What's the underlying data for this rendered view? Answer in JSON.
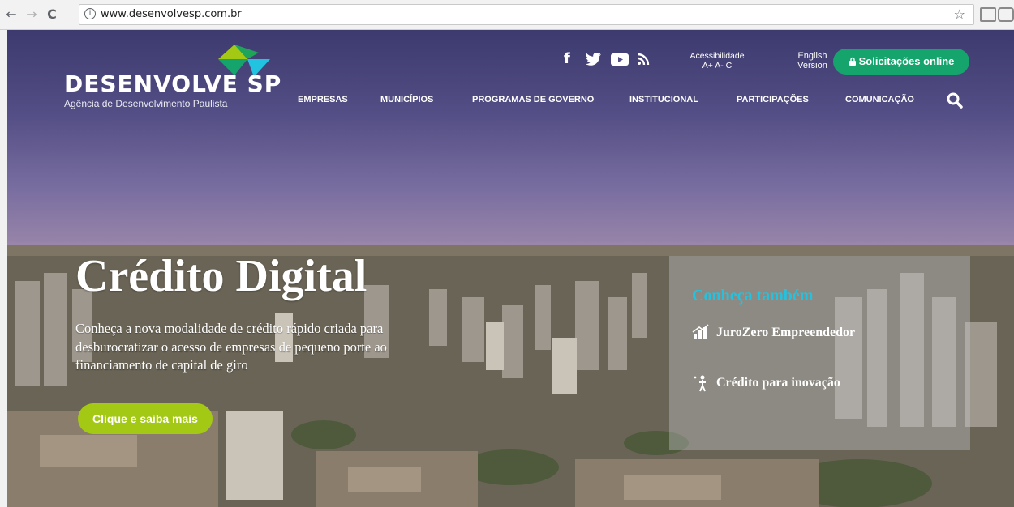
{
  "browser": {
    "url": "www.desenvolvesp.com.br",
    "back": "←",
    "forward": "→",
    "reload": "C",
    "info_icon": "ⓘ",
    "star_icon": "☆"
  },
  "header": {
    "brand_title": "DESENVOLVE SP",
    "brand_sub": "Agência de Desenvolvimento Paulista",
    "accessibility_label": "Acessibilidade",
    "accessibility_controls": "A+ A- C",
    "english_line1": "English",
    "english_line2": "Version",
    "online_button": "Solicitações online",
    "social": [
      "f",
      "y",
      "▶",
      "ʀss"
    ],
    "menu": [
      "EMPRESAS",
      "MUNICÍPIOS",
      "PROGRAMAS DE GOVERNO",
      "INSTITUCIONAL",
      "PARTICIPAÇÕES",
      "COMUNICAÇÃO"
    ]
  },
  "hero": {
    "title": "Crédito Digital",
    "text": "Conheça a nova modalidade de crédito rápido criada para desburocratizar o acesso de empresas de pequeno porte ao financiamento de capital de giro",
    "cta": "Clique e saiba mais"
  },
  "panel": {
    "title": "Conheça também",
    "links": [
      "JuroZero Empreendedor",
      "Crédito para inovação"
    ]
  },
  "colors": {
    "green_button": "#15a56c",
    "lime_button": "#a3c915",
    "panel_title": "#22c3e0"
  }
}
